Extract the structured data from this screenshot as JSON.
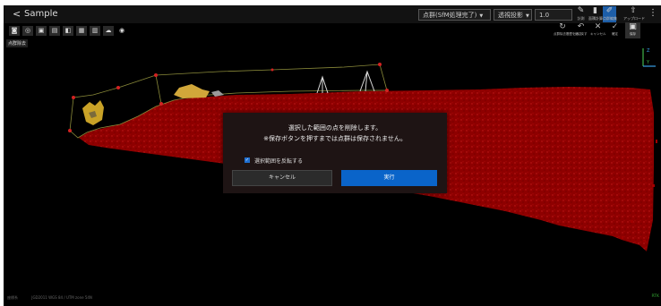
{
  "app": {
    "back_label": "<",
    "title": "Sample"
  },
  "header": {
    "status_dropdown": "点群(SfM処理完了)",
    "mode_dropdown": "透視投影",
    "value_input": "1.0",
    "toolbar": [
      {
        "label": "計測",
        "icon": "ruler-icon"
      },
      {
        "label": "面積計算",
        "icon": "chart-icon"
      },
      {
        "label": "点群編集",
        "icon": "pencil-icon"
      },
      {
        "label": "アップロード",
        "icon": "upload-icon"
      }
    ],
    "more_icon": "⋮"
  },
  "tools": {
    "active_label": "点群除去",
    "icons": [
      "camera-icon",
      "target-icon",
      "select-box-icon",
      "doc-icon",
      "cube-icon",
      "frame-icon",
      "layers-icon",
      "cloud-icon",
      "eye-icon"
    ]
  },
  "actions": [
    {
      "label": "点群除去履歴を消す",
      "icon": "history-icon"
    },
    {
      "label": "元に戻す",
      "icon": "undo-icon"
    },
    {
      "label": "キャンセル",
      "icon": "close-icon"
    },
    {
      "label": "確定",
      "icon": "check-icon"
    },
    {
      "label": "保存",
      "icon": "save-icon"
    }
  ],
  "axis_labels": {
    "z": "Z",
    "y": "Y"
  },
  "dialog": {
    "message_line1": "選択した範囲の点を削除します。",
    "message_line2": "※保存ボタンを押すまでは点群は保存されません。",
    "checkbox_label": "選択範囲を反転する",
    "checkbox_checked": true,
    "cancel_label": "キャンセル",
    "run_label": "実行"
  },
  "footer": {
    "crs_label": "座標系",
    "crs_value": "JGD2011 WGS 84 / UTM zone 54N",
    "status": "RTK"
  },
  "colors": {
    "accent": "#0a64c9",
    "pointcloud": "#9a0000",
    "selection": "#c62828"
  }
}
